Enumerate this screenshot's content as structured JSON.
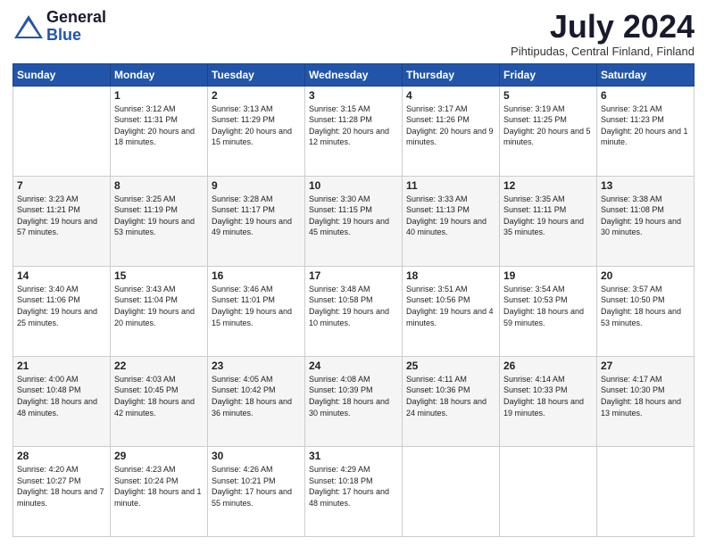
{
  "header": {
    "logo_general": "General",
    "logo_blue": "Blue",
    "month_title": "July 2024",
    "location": "Pihtipudas, Central Finland, Finland"
  },
  "days_of_week": [
    "Sunday",
    "Monday",
    "Tuesday",
    "Wednesday",
    "Thursday",
    "Friday",
    "Saturday"
  ],
  "weeks": [
    [
      {
        "day": "",
        "sunrise": "",
        "sunset": "",
        "daylight": ""
      },
      {
        "day": "1",
        "sunrise": "Sunrise: 3:12 AM",
        "sunset": "Sunset: 11:31 PM",
        "daylight": "Daylight: 20 hours and 18 minutes."
      },
      {
        "day": "2",
        "sunrise": "Sunrise: 3:13 AM",
        "sunset": "Sunset: 11:29 PM",
        "daylight": "Daylight: 20 hours and 15 minutes."
      },
      {
        "day": "3",
        "sunrise": "Sunrise: 3:15 AM",
        "sunset": "Sunset: 11:28 PM",
        "daylight": "Daylight: 20 hours and 12 minutes."
      },
      {
        "day": "4",
        "sunrise": "Sunrise: 3:17 AM",
        "sunset": "Sunset: 11:26 PM",
        "daylight": "Daylight: 20 hours and 9 minutes."
      },
      {
        "day": "5",
        "sunrise": "Sunrise: 3:19 AM",
        "sunset": "Sunset: 11:25 PM",
        "daylight": "Daylight: 20 hours and 5 minutes."
      },
      {
        "day": "6",
        "sunrise": "Sunrise: 3:21 AM",
        "sunset": "Sunset: 11:23 PM",
        "daylight": "Daylight: 20 hours and 1 minute."
      }
    ],
    [
      {
        "day": "7",
        "sunrise": "Sunrise: 3:23 AM",
        "sunset": "Sunset: 11:21 PM",
        "daylight": "Daylight: 19 hours and 57 minutes."
      },
      {
        "day": "8",
        "sunrise": "Sunrise: 3:25 AM",
        "sunset": "Sunset: 11:19 PM",
        "daylight": "Daylight: 19 hours and 53 minutes."
      },
      {
        "day": "9",
        "sunrise": "Sunrise: 3:28 AM",
        "sunset": "Sunset: 11:17 PM",
        "daylight": "Daylight: 19 hours and 49 minutes."
      },
      {
        "day": "10",
        "sunrise": "Sunrise: 3:30 AM",
        "sunset": "Sunset: 11:15 PM",
        "daylight": "Daylight: 19 hours and 45 minutes."
      },
      {
        "day": "11",
        "sunrise": "Sunrise: 3:33 AM",
        "sunset": "Sunset: 11:13 PM",
        "daylight": "Daylight: 19 hours and 40 minutes."
      },
      {
        "day": "12",
        "sunrise": "Sunrise: 3:35 AM",
        "sunset": "Sunset: 11:11 PM",
        "daylight": "Daylight: 19 hours and 35 minutes."
      },
      {
        "day": "13",
        "sunrise": "Sunrise: 3:38 AM",
        "sunset": "Sunset: 11:08 PM",
        "daylight": "Daylight: 19 hours and 30 minutes."
      }
    ],
    [
      {
        "day": "14",
        "sunrise": "Sunrise: 3:40 AM",
        "sunset": "Sunset: 11:06 PM",
        "daylight": "Daylight: 19 hours and 25 minutes."
      },
      {
        "day": "15",
        "sunrise": "Sunrise: 3:43 AM",
        "sunset": "Sunset: 11:04 PM",
        "daylight": "Daylight: 19 hours and 20 minutes."
      },
      {
        "day": "16",
        "sunrise": "Sunrise: 3:46 AM",
        "sunset": "Sunset: 11:01 PM",
        "daylight": "Daylight: 19 hours and 15 minutes."
      },
      {
        "day": "17",
        "sunrise": "Sunrise: 3:48 AM",
        "sunset": "Sunset: 10:58 PM",
        "daylight": "Daylight: 19 hours and 10 minutes."
      },
      {
        "day": "18",
        "sunrise": "Sunrise: 3:51 AM",
        "sunset": "Sunset: 10:56 PM",
        "daylight": "Daylight: 19 hours and 4 minutes."
      },
      {
        "day": "19",
        "sunrise": "Sunrise: 3:54 AM",
        "sunset": "Sunset: 10:53 PM",
        "daylight": "Daylight: 18 hours and 59 minutes."
      },
      {
        "day": "20",
        "sunrise": "Sunrise: 3:57 AM",
        "sunset": "Sunset: 10:50 PM",
        "daylight": "Daylight: 18 hours and 53 minutes."
      }
    ],
    [
      {
        "day": "21",
        "sunrise": "Sunrise: 4:00 AM",
        "sunset": "Sunset: 10:48 PM",
        "daylight": "Daylight: 18 hours and 48 minutes."
      },
      {
        "day": "22",
        "sunrise": "Sunrise: 4:03 AM",
        "sunset": "Sunset: 10:45 PM",
        "daylight": "Daylight: 18 hours and 42 minutes."
      },
      {
        "day": "23",
        "sunrise": "Sunrise: 4:05 AM",
        "sunset": "Sunset: 10:42 PM",
        "daylight": "Daylight: 18 hours and 36 minutes."
      },
      {
        "day": "24",
        "sunrise": "Sunrise: 4:08 AM",
        "sunset": "Sunset: 10:39 PM",
        "daylight": "Daylight: 18 hours and 30 minutes."
      },
      {
        "day": "25",
        "sunrise": "Sunrise: 4:11 AM",
        "sunset": "Sunset: 10:36 PM",
        "daylight": "Daylight: 18 hours and 24 minutes."
      },
      {
        "day": "26",
        "sunrise": "Sunrise: 4:14 AM",
        "sunset": "Sunset: 10:33 PM",
        "daylight": "Daylight: 18 hours and 19 minutes."
      },
      {
        "day": "27",
        "sunrise": "Sunrise: 4:17 AM",
        "sunset": "Sunset: 10:30 PM",
        "daylight": "Daylight: 18 hours and 13 minutes."
      }
    ],
    [
      {
        "day": "28",
        "sunrise": "Sunrise: 4:20 AM",
        "sunset": "Sunset: 10:27 PM",
        "daylight": "Daylight: 18 hours and 7 minutes."
      },
      {
        "day": "29",
        "sunrise": "Sunrise: 4:23 AM",
        "sunset": "Sunset: 10:24 PM",
        "daylight": "Daylight: 18 hours and 1 minute."
      },
      {
        "day": "30",
        "sunrise": "Sunrise: 4:26 AM",
        "sunset": "Sunset: 10:21 PM",
        "daylight": "Daylight: 17 hours and 55 minutes."
      },
      {
        "day": "31",
        "sunrise": "Sunrise: 4:29 AM",
        "sunset": "Sunset: 10:18 PM",
        "daylight": "Daylight: 17 hours and 48 minutes."
      },
      {
        "day": "",
        "sunrise": "",
        "sunset": "",
        "daylight": ""
      },
      {
        "day": "",
        "sunrise": "",
        "sunset": "",
        "daylight": ""
      },
      {
        "day": "",
        "sunrise": "",
        "sunset": "",
        "daylight": ""
      }
    ]
  ]
}
